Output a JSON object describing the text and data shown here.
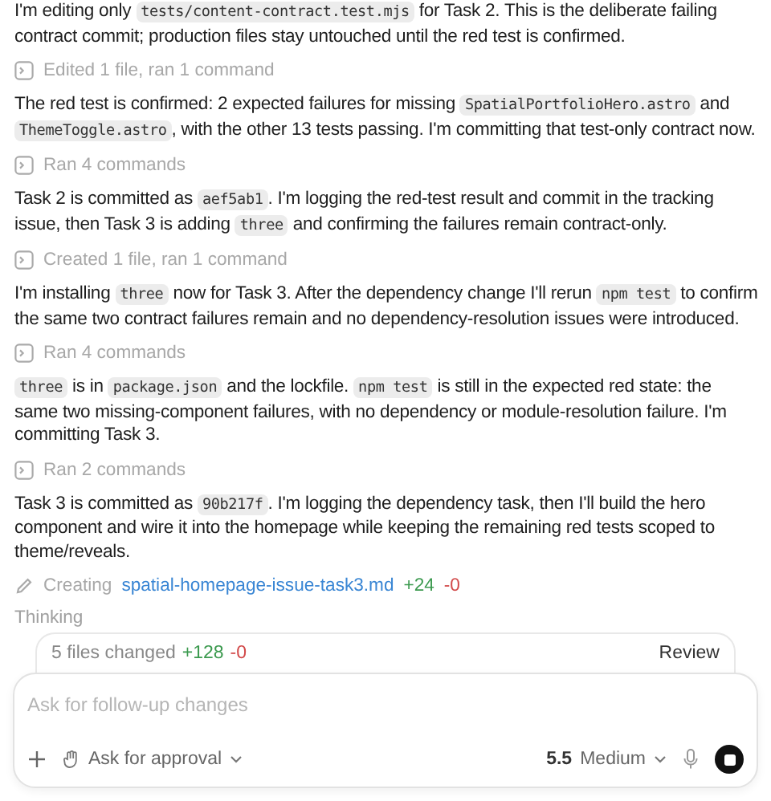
{
  "messages": [
    {
      "kind": "paragraph",
      "segments": [
        {
          "kind": "text",
          "text": "I'm editing only "
        },
        {
          "kind": "code",
          "text": "tests/content-contract.test.mjs"
        },
        {
          "kind": "text",
          "text": " for Task 2. This is the deliberate failing contract commit; production files stay untouched until the red test is confirmed."
        }
      ]
    },
    {
      "kind": "activity",
      "text": "Edited 1 file, ran 1 command"
    },
    {
      "kind": "paragraph",
      "segments": [
        {
          "kind": "text",
          "text": "The red test is confirmed: 2 expected failures for missing "
        },
        {
          "kind": "code",
          "text": "SpatialPortfolioHero.astro"
        },
        {
          "kind": "text",
          "text": " and "
        },
        {
          "kind": "code",
          "text": "ThemeToggle.astro"
        },
        {
          "kind": "text",
          "text": ", with the other 13 tests passing. I'm committing that test-only contract now."
        }
      ]
    },
    {
      "kind": "activity",
      "text": "Ran 4 commands"
    },
    {
      "kind": "paragraph",
      "segments": [
        {
          "kind": "text",
          "text": "Task 2 is committed as "
        },
        {
          "kind": "code",
          "text": "aef5ab1"
        },
        {
          "kind": "text",
          "text": ". I'm logging the red-test result and commit in the tracking issue, then Task 3 is adding "
        },
        {
          "kind": "code",
          "text": "three"
        },
        {
          "kind": "text",
          "text": " and confirming the failures remain contract-only."
        }
      ]
    },
    {
      "kind": "activity",
      "text": "Created 1 file, ran 1 command"
    },
    {
      "kind": "paragraph",
      "segments": [
        {
          "kind": "text",
          "text": "I'm installing "
        },
        {
          "kind": "code",
          "text": "three"
        },
        {
          "kind": "text",
          "text": " now for Task 3. After the dependency change I'll rerun "
        },
        {
          "kind": "code",
          "text": "npm test"
        },
        {
          "kind": "text",
          "text": " to confirm the same two contract failures remain and no dependency-resolution issues were introduced."
        }
      ]
    },
    {
      "kind": "activity",
      "text": "Ran 4 commands"
    },
    {
      "kind": "paragraph",
      "segments": [
        {
          "kind": "code",
          "text": "three"
        },
        {
          "kind": "text",
          "text": " is in "
        },
        {
          "kind": "code",
          "text": "package.json"
        },
        {
          "kind": "text",
          "text": " and the lockfile. "
        },
        {
          "kind": "code",
          "text": "npm test"
        },
        {
          "kind": "text",
          "text": " is still in the expected red state: the same two missing-component failures, with no dependency or module-resolution failure. I'm committing Task 3."
        }
      ]
    },
    {
      "kind": "activity",
      "text": "Ran 2 commands"
    },
    {
      "kind": "paragraph",
      "segments": [
        {
          "kind": "text",
          "text": "Task 3 is committed as "
        },
        {
          "kind": "code",
          "text": "90b217f"
        },
        {
          "kind": "text",
          "text": ". I'm logging the dependency task, then I'll build the hero component and wire it into the homepage while keeping the remaining red tests scoped to theme/reveals."
        }
      ]
    },
    {
      "kind": "creating",
      "label": "Creating",
      "file": "spatial-homepage-issue-task3.md",
      "added": "+24",
      "removed": "-0"
    },
    {
      "kind": "status",
      "text": "Thinking"
    }
  ],
  "changes": {
    "summary": "5 files changed",
    "added": "+128",
    "removed": "-0",
    "review": "Review"
  },
  "composer": {
    "placeholder": "Ask for follow-up changes",
    "approval": "Ask for approval",
    "model": "5.5",
    "effort": "Medium"
  }
}
